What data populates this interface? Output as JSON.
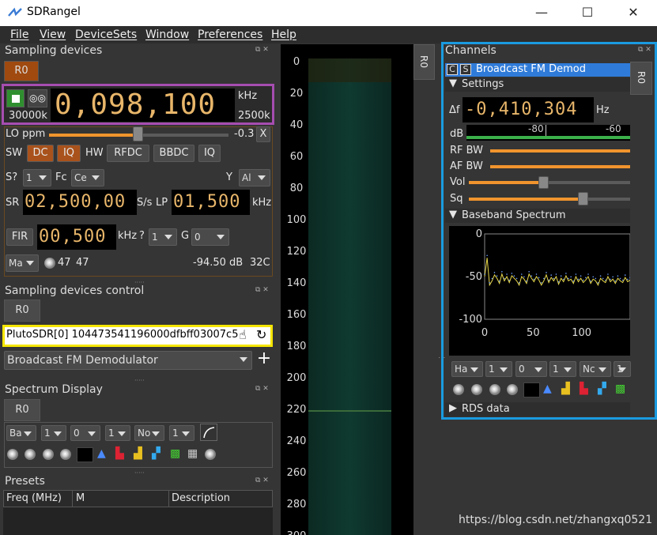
{
  "window": {
    "title": "SDRangel",
    "min": "—",
    "max": "☐",
    "close": "✕"
  },
  "menu": [
    "File",
    "View",
    "DeviceSets",
    "Window",
    "Preferences",
    "Help"
  ],
  "sampling": {
    "title": "Sampling devices",
    "tab": "R0",
    "freq": "0,098,100",
    "freq_unit": "kHz",
    "sample_rate_left": "30000k",
    "sample_rate_right": "2500k",
    "lo_label": "LO ppm",
    "lo_value": "-0.3",
    "lo_close": "X",
    "sw_label": "SW",
    "dc": "DC",
    "iq": "IQ",
    "hw_label": "HW",
    "rfdc": "RFDC",
    "bbdc": "BBDC",
    "iq2": "IQ",
    "s_label": "S?",
    "s_val": "1",
    "fc_label": "Fc",
    "fc_val": "Ce",
    "ant_label": "Y",
    "ant_val": "Al",
    "sr_label": "SR",
    "sr_val": "02,500,00",
    "sr_unit": "S/s",
    "lp_label": "LP",
    "lp_val": "01,500",
    "lp_unit": "kHz",
    "fir_btn": "FIR",
    "fir_val": "00,500",
    "fir_unit": "kHz",
    "q_label": "?",
    "q_val": "1",
    "g_label": "G",
    "g_val": "0",
    "mode_val": "Ma",
    "gain1": "47",
    "gain2": "47",
    "db": "-94.50 dB",
    "temp": "32C"
  },
  "control": {
    "title": "Sampling devices control",
    "tab": "R0",
    "device": "PlutoSDR[0] 104473541196000dfbff03007c5",
    "channel_select": "Broadcast FM Demodulator",
    "add": "+"
  },
  "spectrum_display": {
    "title": "Spectrum Display",
    "tab": "R0",
    "combos": [
      "Ba",
      "1",
      "0",
      "1",
      "No",
      "1"
    ]
  },
  "presets": {
    "title": "Presets",
    "col_freq": "Freq (MHz)",
    "col_m": "M",
    "col_desc": "Description"
  },
  "waterfall": {
    "ticks": [
      "0",
      "20",
      "40",
      "60",
      "80",
      "100",
      "120",
      "140",
      "160",
      "180",
      "200",
      "220",
      "240",
      "260",
      "280",
      "300"
    ],
    "tab": "R0"
  },
  "channels": {
    "title": "Channels",
    "tab": "R0",
    "c_badge": "C",
    "s_badge": "S",
    "demod": "Broadcast FM Demod",
    "settings": "Settings",
    "df_label": "Δf",
    "df_val": "-0,410,304",
    "df_unit": "Hz",
    "db_label": "dB",
    "db_scale1": "-80",
    "db_scale2": "-60",
    "rfbw": "RF BW",
    "afbw": "AF BW",
    "vol": "Vol",
    "sq": "Sq",
    "baseband": "Baseband Spectrum",
    "rds": "RDS data",
    "combos": [
      "Ha",
      "1",
      "0",
      "1",
      "Nc",
      "1"
    ]
  },
  "chart_data": {
    "type": "line",
    "ylabel": "",
    "xlabel": "",
    "xlim": [
      0,
      150
    ],
    "ylim": [
      -100,
      0
    ],
    "x_ticks": [
      "0",
      "50",
      "100"
    ],
    "y_ticks": [
      "0",
      "-50",
      "-100"
    ],
    "series": [
      {
        "values": [
          -50,
          -28,
          -60,
          -55,
          -48,
          -52,
          -58,
          -47,
          -55,
          -50,
          -57,
          -49,
          -52,
          -55,
          -60,
          -50,
          -53,
          -58,
          -47,
          -52,
          -56,
          -50,
          -54,
          -60,
          -55,
          -48,
          -57,
          -51,
          -55,
          -50,
          -59,
          -52,
          -56,
          -49,
          -55,
          -53,
          -58,
          -50,
          -56,
          -52,
          -57,
          -54,
          -50,
          -58,
          -53,
          -55,
          -60,
          -52,
          -55,
          -57,
          -50,
          -56,
          -53,
          -58,
          -52,
          -55,
          -57,
          -51,
          -56,
          -54
        ]
      }
    ]
  },
  "watermark": "https://blog.csdn.net/zhangxq0521",
  "colors": {
    "accent": "#f0942d",
    "highlight_purple": "#a64db0",
    "highlight_yellow": "#f5e600",
    "highlight_blue": "#1a9be0"
  }
}
